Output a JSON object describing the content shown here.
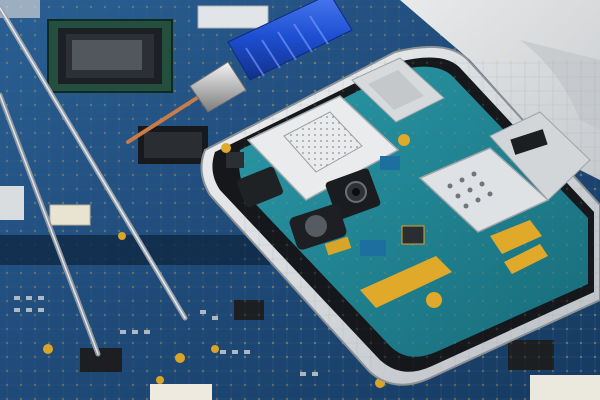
{
  "scene": {
    "subject": "smartphone-repair",
    "colors": {
      "board_blue": "#1f4a78",
      "board_dark": "#12304f",
      "phone_pcb_teal": "#1e7f8f",
      "phone_frame_silver": "#d9dcdf",
      "screwdriver_blue": "#1d4fd1",
      "gold": "#d9a528",
      "chip_black": "#1b1d20"
    }
  }
}
